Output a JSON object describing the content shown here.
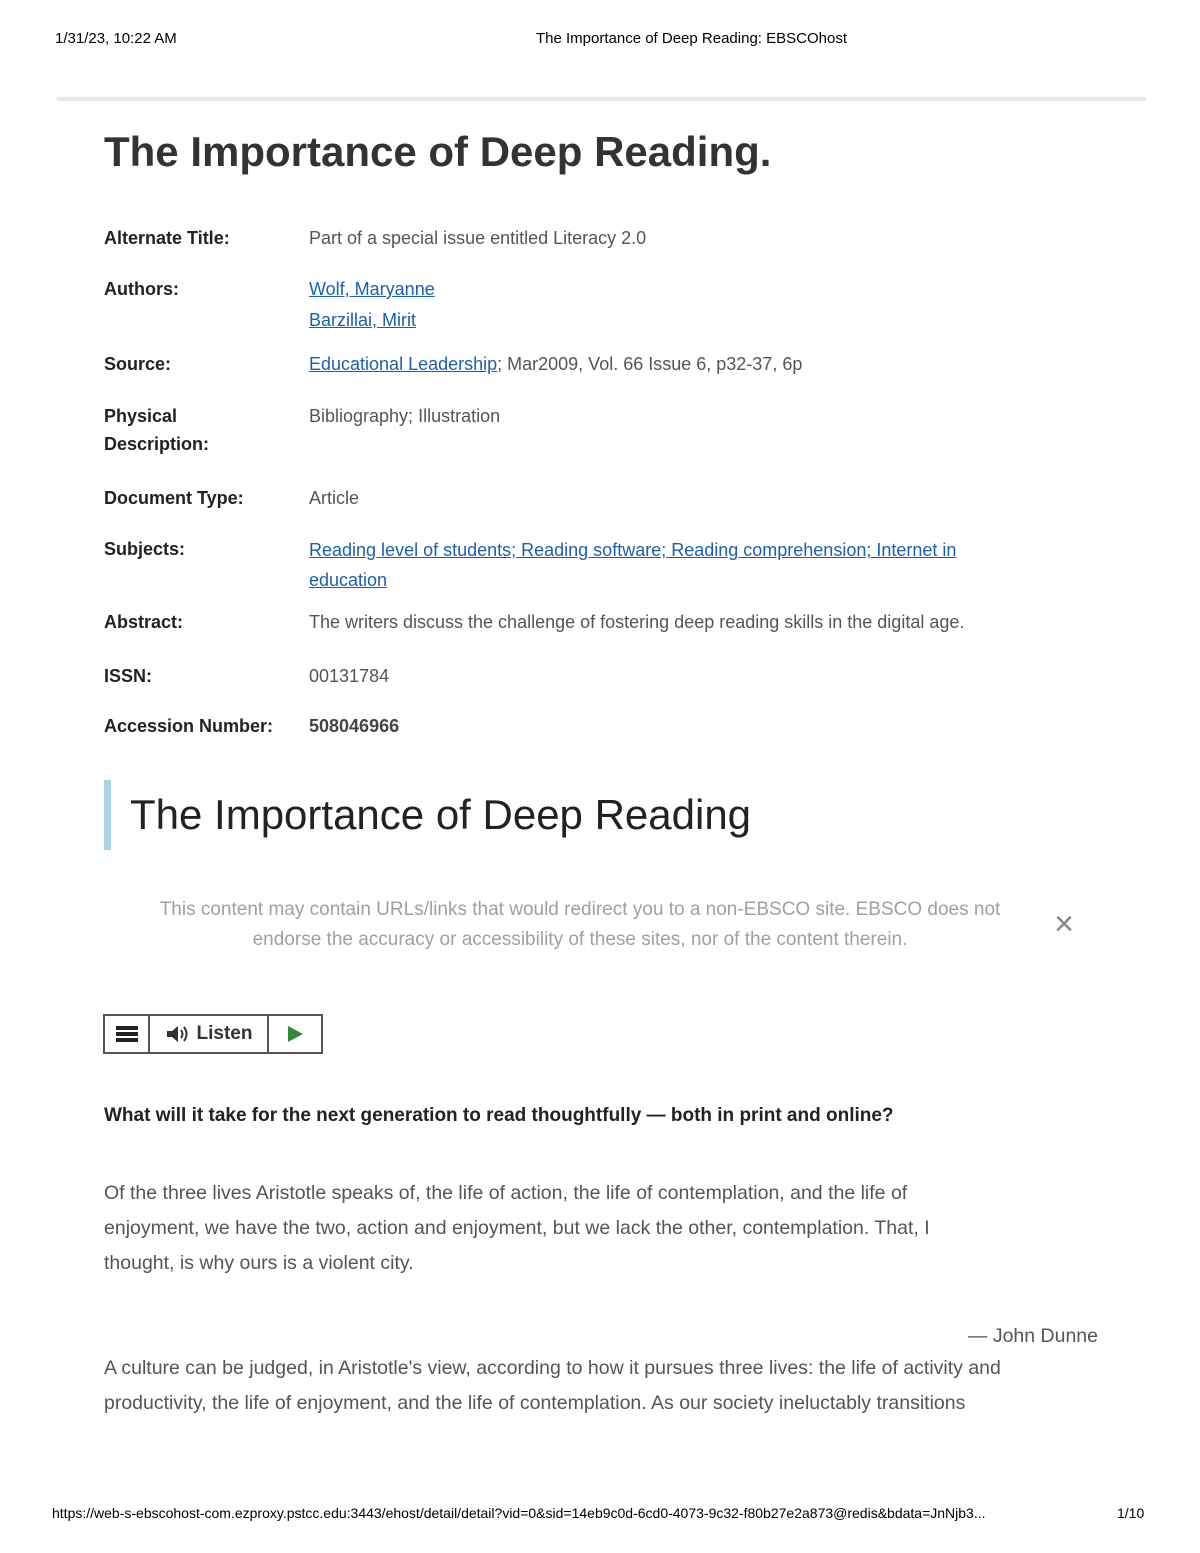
{
  "print_header": {
    "datetime": "1/31/23, 10:22 AM",
    "page_title": "The Importance of Deep Reading: EBSCOhost"
  },
  "record": {
    "title": "The Importance of Deep Reading.",
    "fields": {
      "alternate_title": {
        "label": "Alternate Title:",
        "value": "Part of a special issue entitled Literacy 2.0"
      },
      "authors": {
        "label": "Authors:",
        "values": [
          "Wolf, Maryanne",
          "Barzillai, Mirit"
        ]
      },
      "source": {
        "label": "Source:",
        "link": "Educational Leadership",
        "rest": "; Mar2009, Vol. 66 Issue 6, p32-37, 6p"
      },
      "physical_description": {
        "label_line1": "Physical",
        "label_line2": "Description:",
        "value": "Bibliography; Illustration"
      },
      "document_type": {
        "label": "Document Type:",
        "value": "Article"
      },
      "subjects": {
        "label": "Subjects:",
        "line1": "Reading level of students; Reading software; Reading comprehension; Internet in",
        "line2": "education"
      },
      "abstract": {
        "label": "Abstract:",
        "value": "The writers discuss the challenge of fostering deep reading skills in the digital age."
      },
      "issn": {
        "label": "ISSN:",
        "value": "00131784"
      },
      "accession_number": {
        "label": "Accession Number:",
        "value": "508046966"
      }
    }
  },
  "article": {
    "heading": "The Importance of Deep Reading",
    "disclaimer_line1": "This content may contain URLs/links that would redirect you to a non-EBSCO site. EBSCO does not",
    "disclaimer_line2": "endorse the accuracy or accessibility of these sites, nor of the content therein.",
    "listen_label": "Listen",
    "lead_question": "What will it take for the next generation to read thoughtfully — both in print and online?",
    "epigraph_line1": "Of the three lives Aristotle speaks of, the life of action, the life of contemplation, and the life of",
    "epigraph_line2": "enjoyment, we have the two, action and enjoyment, but we lack the other, contemplation. That, I",
    "epigraph_line3": "thought, is why ours is a violent city.",
    "attribution": "— John Dunne",
    "body_line1": "A culture can be judged, in Aristotle's view, according to how it pursues three lives: the life of activity and",
    "body_line2": "productivity, the life of enjoyment, and the life of contemplation. As our society ineluctably transitions"
  },
  "print_footer": {
    "url": "https://web-s-ebscohost-com.ezproxy.pstcc.edu:3443/ehost/detail/detail?vid=0&sid=14eb9c0d-6cd0-4073-9c32-f80b27e2a873@redis&bdata=JnNjb3...",
    "page": "1/10"
  },
  "colors": {
    "link": "#1a5fb4",
    "heading_accent": "#a8d4e6",
    "play_icon": "#2e8b3a"
  }
}
